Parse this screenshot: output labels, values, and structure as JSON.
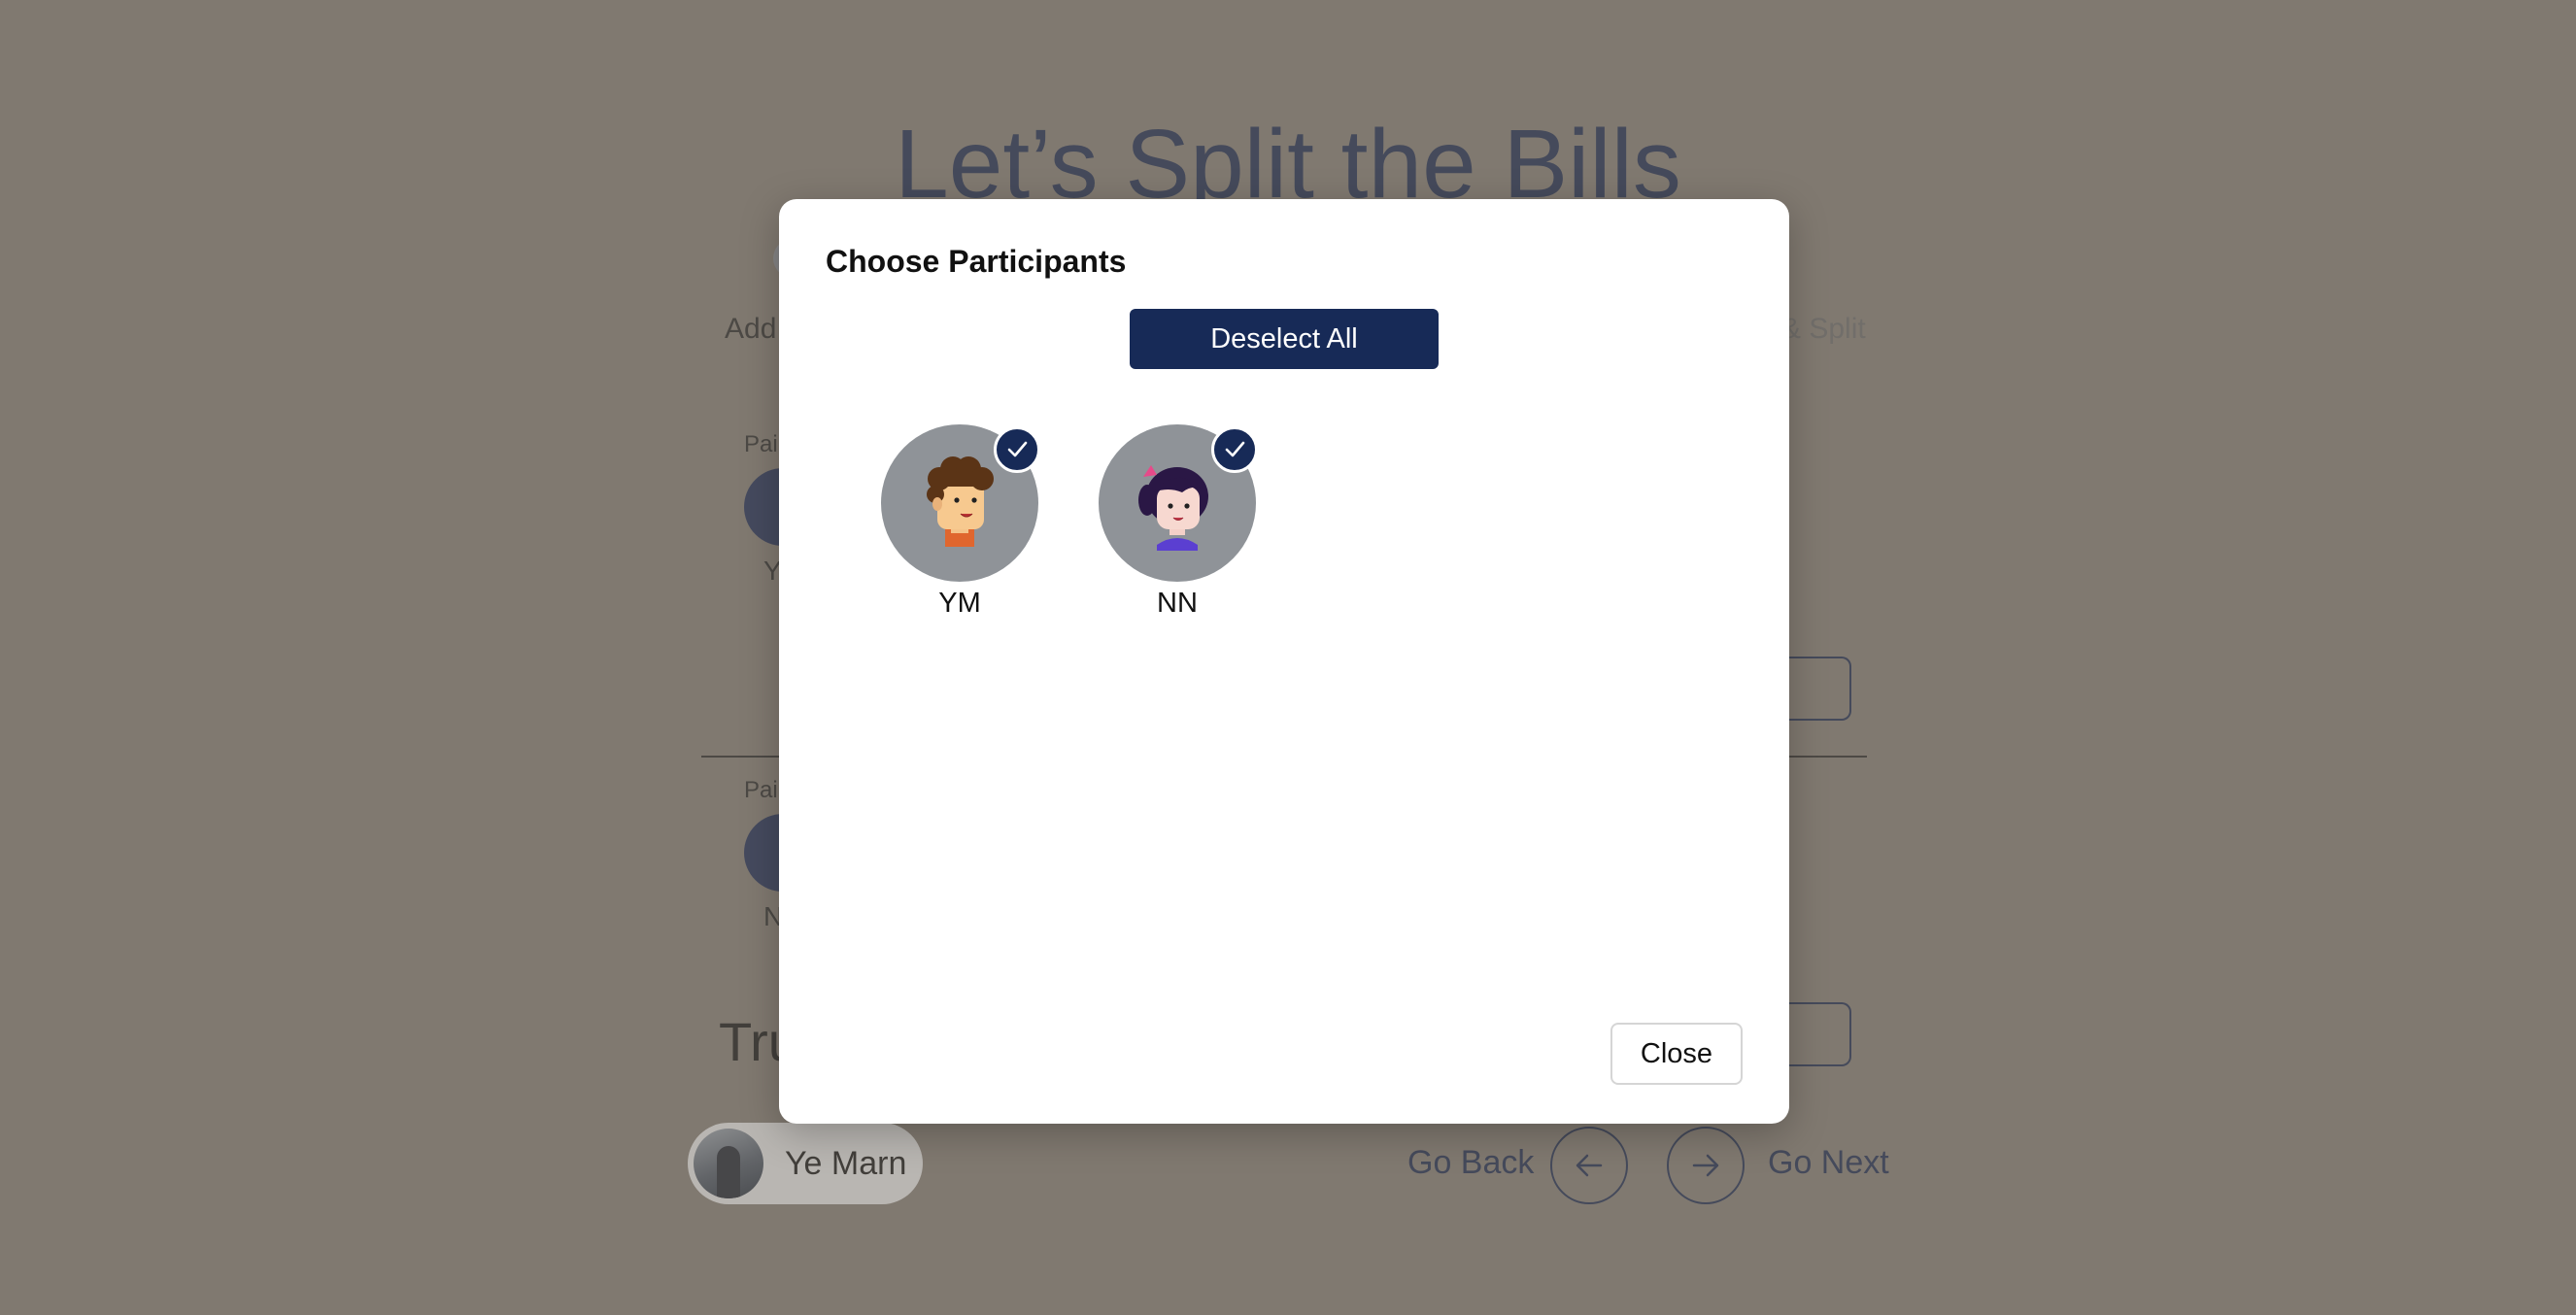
{
  "page": {
    "title": "Let’s Split the Bills",
    "steps": {
      "left_label": "Add",
      "right_label": "& Split"
    },
    "payers": [
      {
        "label": "Pai",
        "initial": "Y"
      },
      {
        "label": "Pai",
        "initial": "N"
      }
    ],
    "truncated_text": "Tru",
    "user": {
      "name": "Ye Marn"
    },
    "nav": {
      "back_label": "Go Back",
      "next_label": "Go Next"
    }
  },
  "modal": {
    "title": "Choose Participants",
    "deselect_label": "Deselect All",
    "participants": [
      {
        "initials": "YM",
        "selected": true
      },
      {
        "initials": "NN",
        "selected": true
      }
    ],
    "close_label": "Close"
  },
  "colors": {
    "primary": "#172a57",
    "overlay": "#807970",
    "avatar_bg": "#8f9398"
  }
}
